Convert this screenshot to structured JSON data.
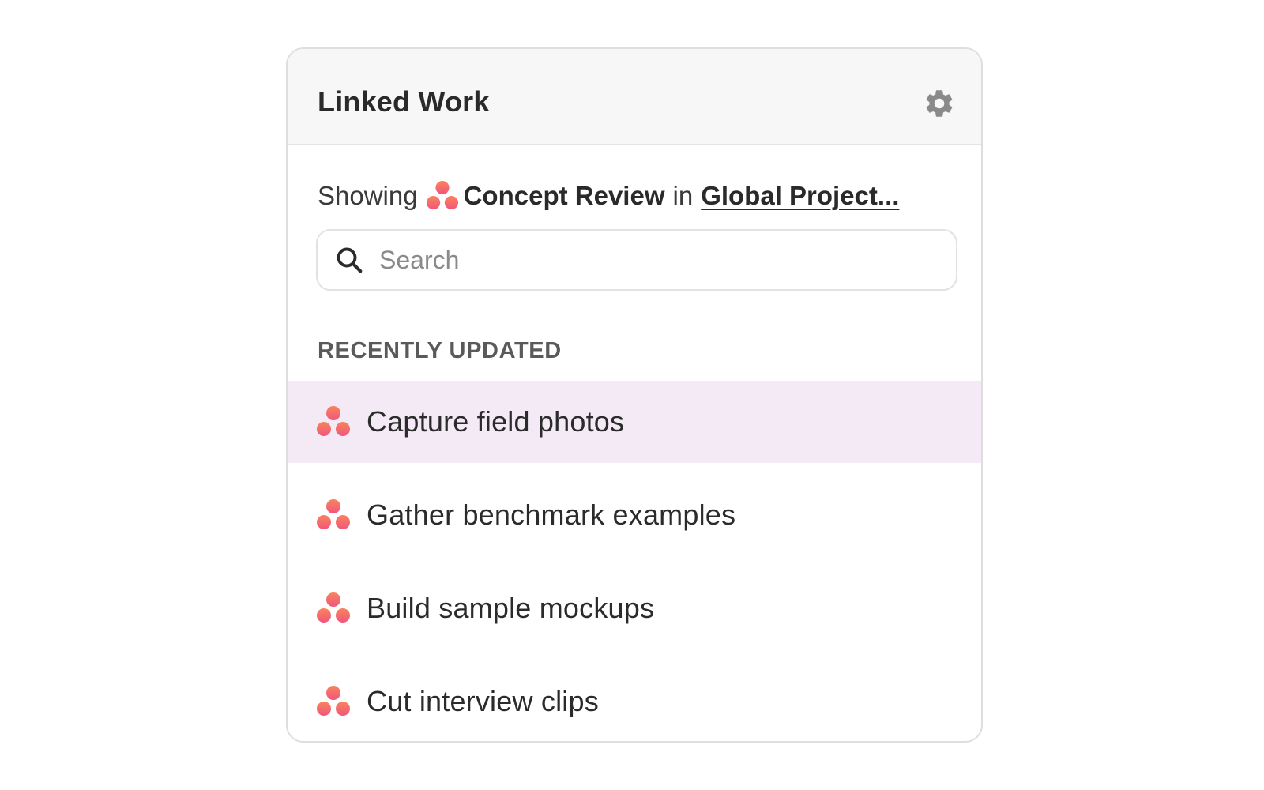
{
  "header": {
    "title": "Linked Work",
    "settings_icon": "gear-icon"
  },
  "context": {
    "prefix": "Showing",
    "project_name": "Concept Review",
    "connector": "in",
    "portfolio_link": "Global Project..."
  },
  "search": {
    "placeholder": "Search",
    "value": ""
  },
  "section": {
    "label": "RECENTLY UPDATED"
  },
  "items": [
    {
      "label": "Capture field photos",
      "highlighted": true
    },
    {
      "label": "Gather benchmark examples",
      "highlighted": false
    },
    {
      "label": "Build sample mockups",
      "highlighted": false
    },
    {
      "label": "Cut interview clips",
      "highlighted": false
    }
  ],
  "colors": {
    "logo_top": "#f6736b",
    "logo_bottom": "#f25c7a",
    "highlight_bg": "#f3eaf6",
    "gear": "#8a8a8a"
  }
}
